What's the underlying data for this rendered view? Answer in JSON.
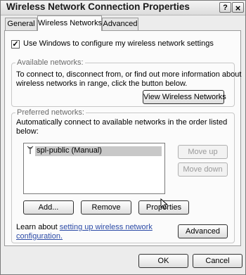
{
  "window": {
    "title": "Wireless Network Connection Properties",
    "help_icon": "?",
    "close_icon": "×"
  },
  "tabs": [
    {
      "label": "General",
      "active": false
    },
    {
      "label": "Wireless Networks",
      "active": true
    },
    {
      "label": "Advanced",
      "active": false
    }
  ],
  "use_windows": {
    "label": "Use Windows to configure my wireless network settings",
    "checked": true,
    "check_glyph": "✓"
  },
  "available": {
    "legend": "Available networks:",
    "line1": "To connect to, disconnect from, or find out more information about",
    "line2": "wireless networks in range, click the button below.",
    "view_button": "View Wireless Networks"
  },
  "preferred": {
    "legend": "Preferred networks:",
    "line1": "Automatically connect to available networks in the order listed",
    "line2": "below:",
    "networks": [
      {
        "name": "spl-public (Manual)",
        "icon": "wireless-antenna-icon"
      }
    ],
    "move_up": "Move up",
    "move_down": "Move down",
    "add": "Add...",
    "remove": "Remove",
    "properties": "Properties"
  },
  "learn": {
    "prefix": "Learn about ",
    "link_line1": "setting up wireless network",
    "link_line2": "configuration."
  },
  "advanced_button": "Advanced",
  "footer": {
    "ok": "OK",
    "cancel": "Cancel"
  },
  "colors": {
    "dialog_bg": "#ececec",
    "panel_bg": "#fbfbfb",
    "link": "#2b4aa6",
    "selection": "#c8c8c8"
  }
}
